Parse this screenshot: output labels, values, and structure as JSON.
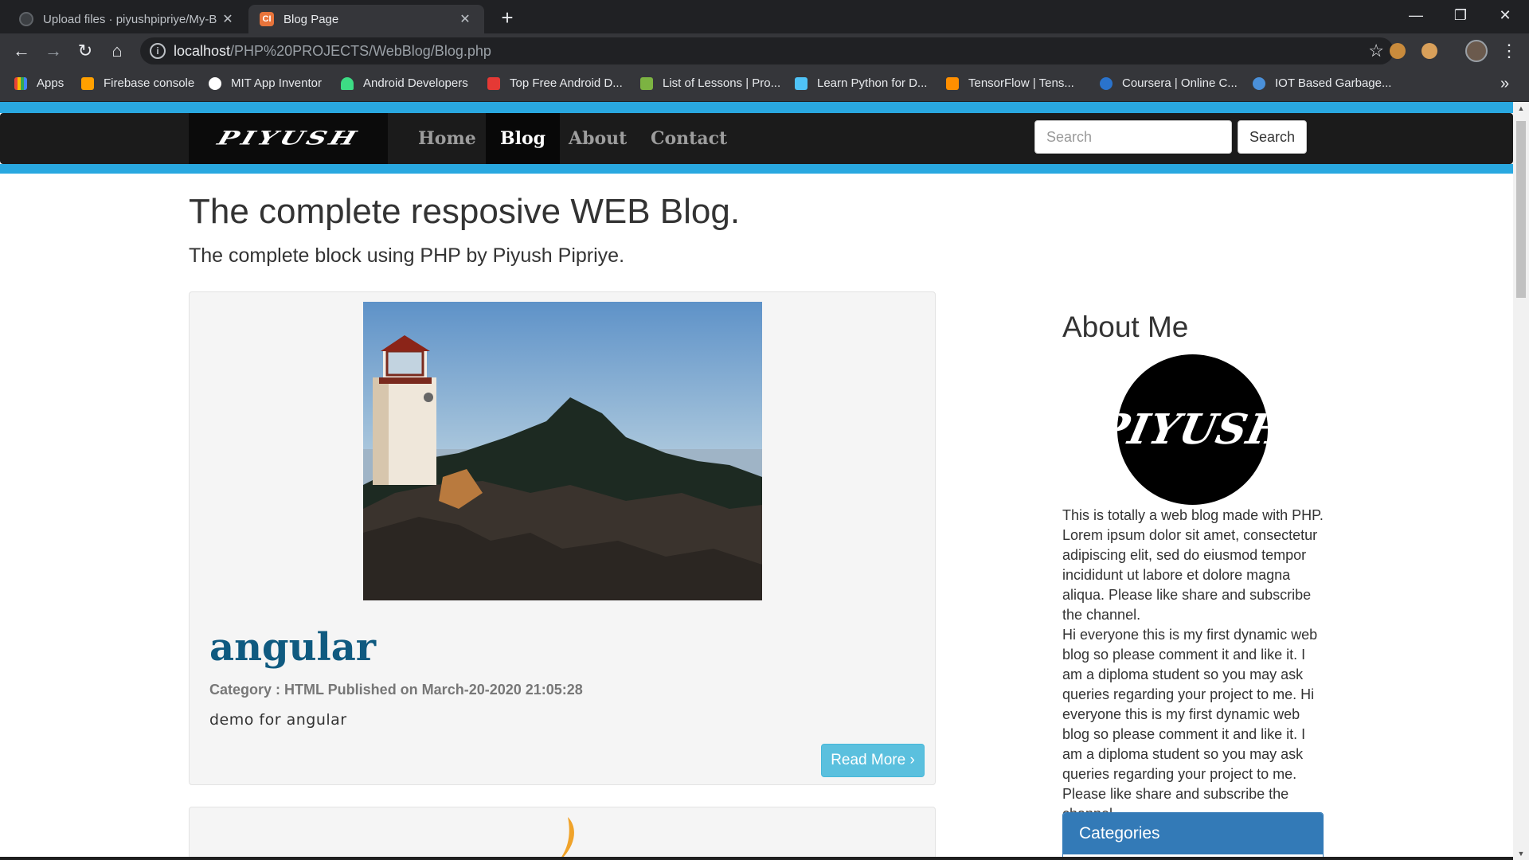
{
  "browser": {
    "tabs": [
      {
        "title": "Upload files · piyushpipriye/My-B"
      },
      {
        "title": "Blog Page"
      }
    ],
    "url_host": "localhost",
    "url_path": "/PHP%20PROJECTS/WebBlog/Blog.php",
    "bookmarks": [
      "Apps",
      "Firebase console",
      "MIT App Inventor",
      "Android Developers",
      "Top Free Android D...",
      "List of Lessons | Pro...",
      "Learn Python for D...",
      "TensorFlow  |  Tens...",
      "Coursera | Online C...",
      "IOT Based Garbage..."
    ]
  },
  "site": {
    "brand": "PIYUSH",
    "nav": [
      "Home",
      "Blog",
      "About",
      "Contact"
    ],
    "active_nav": "Blog",
    "search_placeholder": "Search",
    "search_button": "Search"
  },
  "header": {
    "title": "The complete resposive WEB Blog.",
    "subtitle": "The complete block using PHP by Piyush Pipriye."
  },
  "posts": [
    {
      "title": "angular",
      "meta": "Category : HTML Published on March-20-2020 21:05:28",
      "excerpt": "demo for angular",
      "read_more": "Read More ›"
    }
  ],
  "sidebar": {
    "about_heading": "About Me",
    "avatar_text": "PIYUSH",
    "about_p1": "This is totally a web blog made with PHP. Lorem ipsum dolor sit amet, consectetur adipiscing elit, sed do eiusmod tempor incididunt ut labore et dolore magna aliqua. Please like share and subscribe the channel.",
    "about_p2": "Hi everyone this is my first dynamic web blog so please comment it and like it. I am a diploma student so you may ask queries regarding your project to me. Hi everyone this is my first dynamic web blog so please comment it and like it. I am a diploma student so you may ask queries regarding your project to me. Please like share and subscribe the channel.",
    "categories_heading": "Categories"
  },
  "colors": {
    "accent_blue": "#29a8e0",
    "navbar_bg": "#1b1b1b",
    "post_title": "#0f5a80",
    "read_more_bg": "#5bc0de",
    "categories_bg": "#337ab7"
  }
}
